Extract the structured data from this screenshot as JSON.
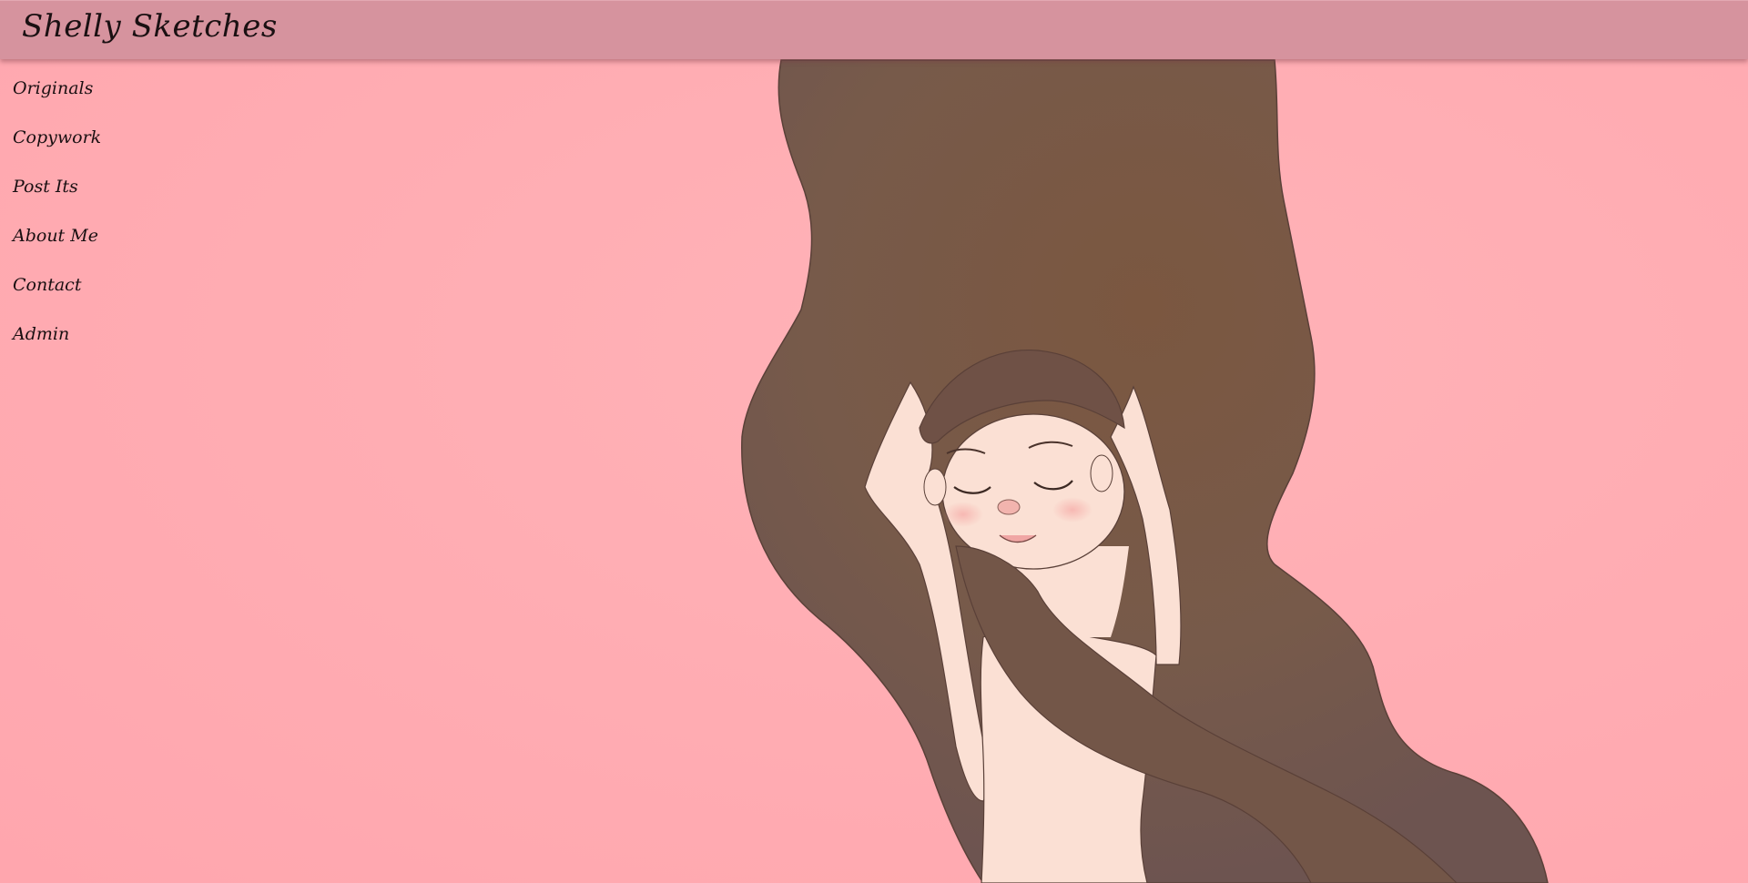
{
  "header": {
    "title": "Shelly Sketches",
    "background_color": "#d6939e"
  },
  "nav": {
    "items": [
      {
        "label": "Originals"
      },
      {
        "label": "Copywork"
      },
      {
        "label": "Post Its"
      },
      {
        "label": "About Me"
      },
      {
        "label": "Contact"
      },
      {
        "label": "Admin"
      }
    ]
  },
  "theme": {
    "page_background": "#ffadb3",
    "hair_color": "#7a5a48",
    "skin_color": "#fbe0d4"
  },
  "hero": {
    "image": "illustration-girl-long-brown-hair-arms-raised-eyes-closed"
  }
}
